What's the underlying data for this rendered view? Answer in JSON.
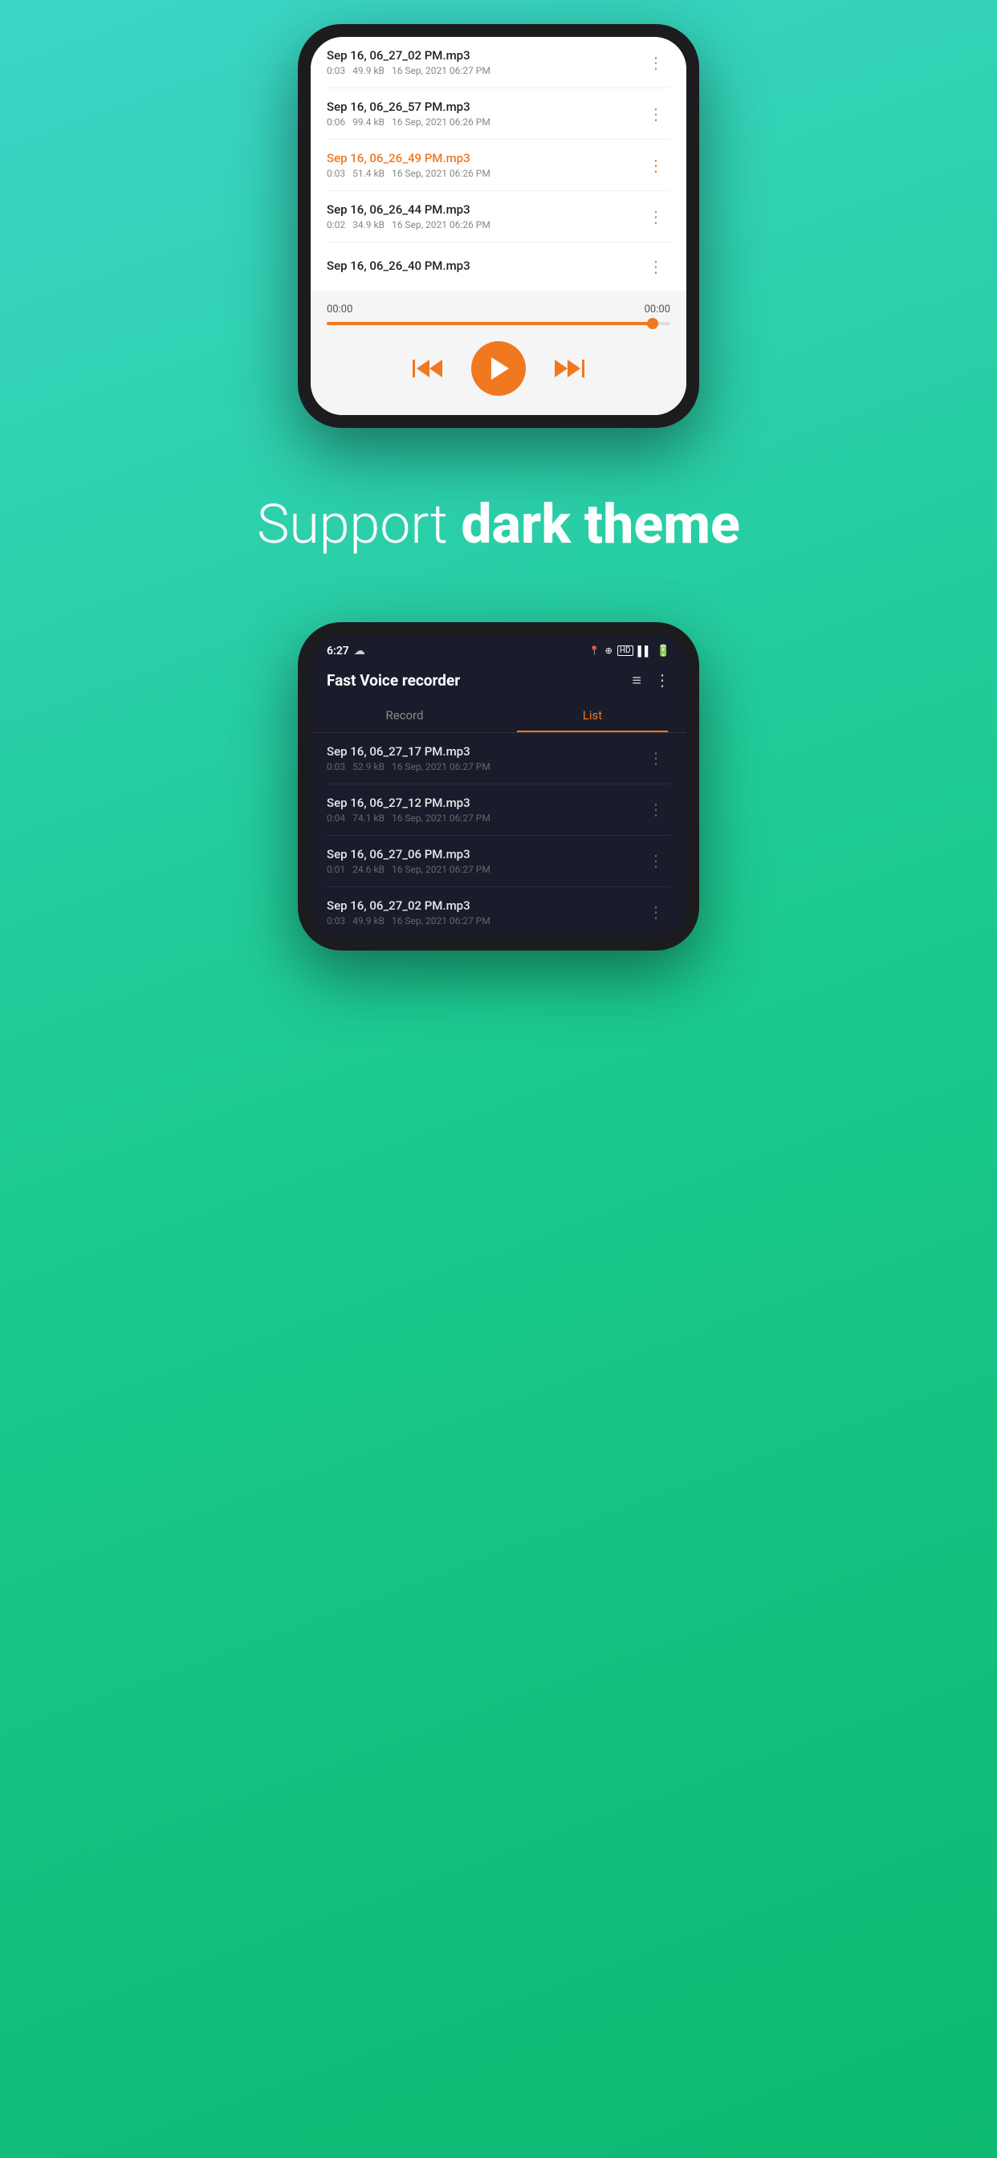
{
  "background": {
    "gradient_start": "#3dd6c8",
    "gradient_end": "#0db870"
  },
  "top_phone": {
    "recordings": [
      {
        "name": "Sep 16, 06_27_02 PM.mp3",
        "duration": "0:03",
        "size": "49.9 kB",
        "date": "16 Sep, 2021 06:27 PM",
        "active": false
      },
      {
        "name": "Sep 16, 06_26_57 PM.mp3",
        "duration": "0:06",
        "size": "99.4 kB",
        "date": "16 Sep, 2021 06:26 PM",
        "active": false
      },
      {
        "name": "Sep 16, 06_26_49 PM.mp3",
        "duration": "0:03",
        "size": "51.4 kB",
        "date": "16 Sep, 2021 06:26 PM",
        "active": true
      },
      {
        "name": "Sep 16, 06_26_44 PM.mp3",
        "duration": "0:02",
        "size": "34.9 kB",
        "date": "16 Sep, 2021 06:26 PM",
        "active": false
      },
      {
        "name": "Sep 16, 06_26_40 PM.mp3",
        "duration": "",
        "size": "",
        "date": "",
        "active": false
      }
    ],
    "player": {
      "time_current": "00:00",
      "time_total": "00:00",
      "progress_percent": 95
    }
  },
  "middle": {
    "line1": "Support ",
    "line2": "dark theme"
  },
  "bottom_phone": {
    "status_bar": {
      "time": "6:27",
      "weather_icon": "☁",
      "signal_icons": "📍 ⊕ ᴴᴰ ▌▌ 🔋"
    },
    "app_bar": {
      "title": "Fast Voice recorder",
      "sort_icon": "≡",
      "more_icon": "⋮"
    },
    "tabs": [
      {
        "label": "Record",
        "active": false
      },
      {
        "label": "List",
        "active": true
      }
    ],
    "recordings": [
      {
        "name": "Sep 16, 06_27_17 PM.mp3",
        "duration": "0:03",
        "size": "52.9 kB",
        "date": "16 Sep, 2021 06:27 PM"
      },
      {
        "name": "Sep 16, 06_27_12 PM.mp3",
        "duration": "0:04",
        "size": "74.1 kB",
        "date": "16 Sep, 2021 06:27 PM"
      },
      {
        "name": "Sep 16, 06_27_06 PM.mp3",
        "duration": "0:01",
        "size": "24.6 kB",
        "date": "16 Sep, 2021 06:27 PM"
      },
      {
        "name": "Sep 16, 06_27_02 PM.mp3",
        "duration": "0:03",
        "size": "49.9 kB",
        "date": "16 Sep, 2021 06:27 PM"
      }
    ]
  }
}
